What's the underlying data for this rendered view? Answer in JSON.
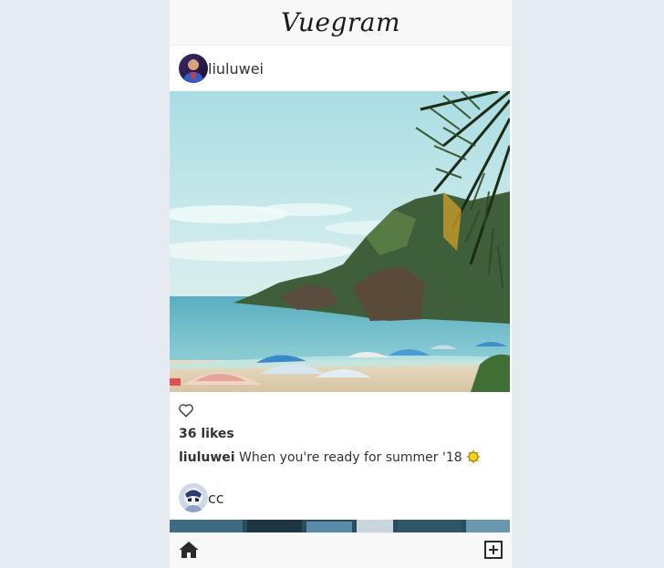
{
  "app": {
    "brand": "Vuegram"
  },
  "post1": {
    "username": "liuluwei",
    "likes": "36 likes",
    "caption_user": "liuluwei",
    "caption_text": "When you're ready for summer '18"
  },
  "post2": {
    "username": "cc"
  },
  "icons": {
    "like": "heart-outline-icon",
    "home": "home-icon",
    "add": "plus-square-icon",
    "emoji": "sun-emoji-icon"
  },
  "colors": {
    "background": "#e6ebf2",
    "header_bg": "#f8f8f8",
    "text": "#333333"
  }
}
